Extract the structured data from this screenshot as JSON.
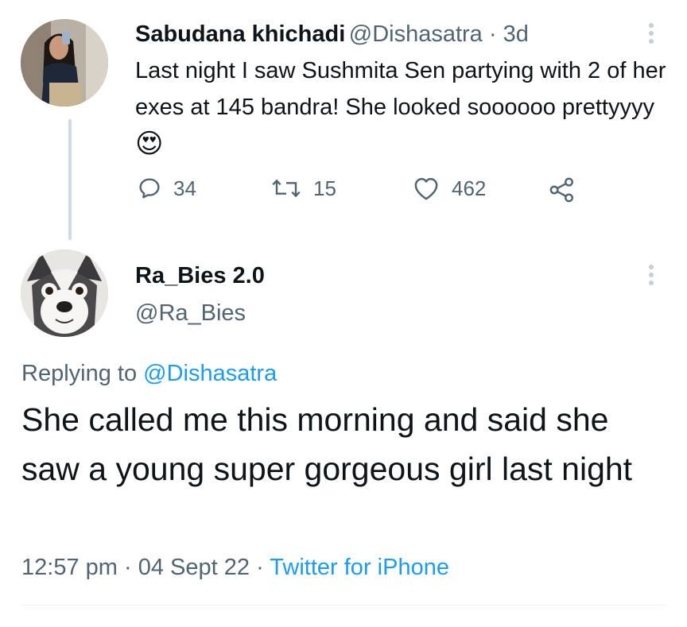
{
  "tweet1": {
    "display_name": "Sabudana khichadi",
    "handle_time": "@Dishasatra · 3d",
    "text": "Last night I saw Sushmita Sen partying with 2 of her exes at 145 bandra! She looked soooooo prettyyyy",
    "emoji": "😍",
    "replies": "34",
    "retweets": "15",
    "likes": "462"
  },
  "tweet2": {
    "display_name": "Ra_Bies 2.0",
    "handle": "@Ra_Bies",
    "replying_prefix": "Replying to",
    "replying_to": "@Dishasatra",
    "text": "She called me this morning and said she saw a young super gorgeous girl last night",
    "time": "12:57 pm",
    "date": "04 Sept 22",
    "source": "Twitter for iPhone"
  },
  "colors": {
    "link": "#1d9bf0",
    "muted": "#536471",
    "text": "#0f1419"
  },
  "icons": [
    "reply-icon",
    "retweet-icon",
    "like-icon",
    "share-icon",
    "more-icon"
  ]
}
